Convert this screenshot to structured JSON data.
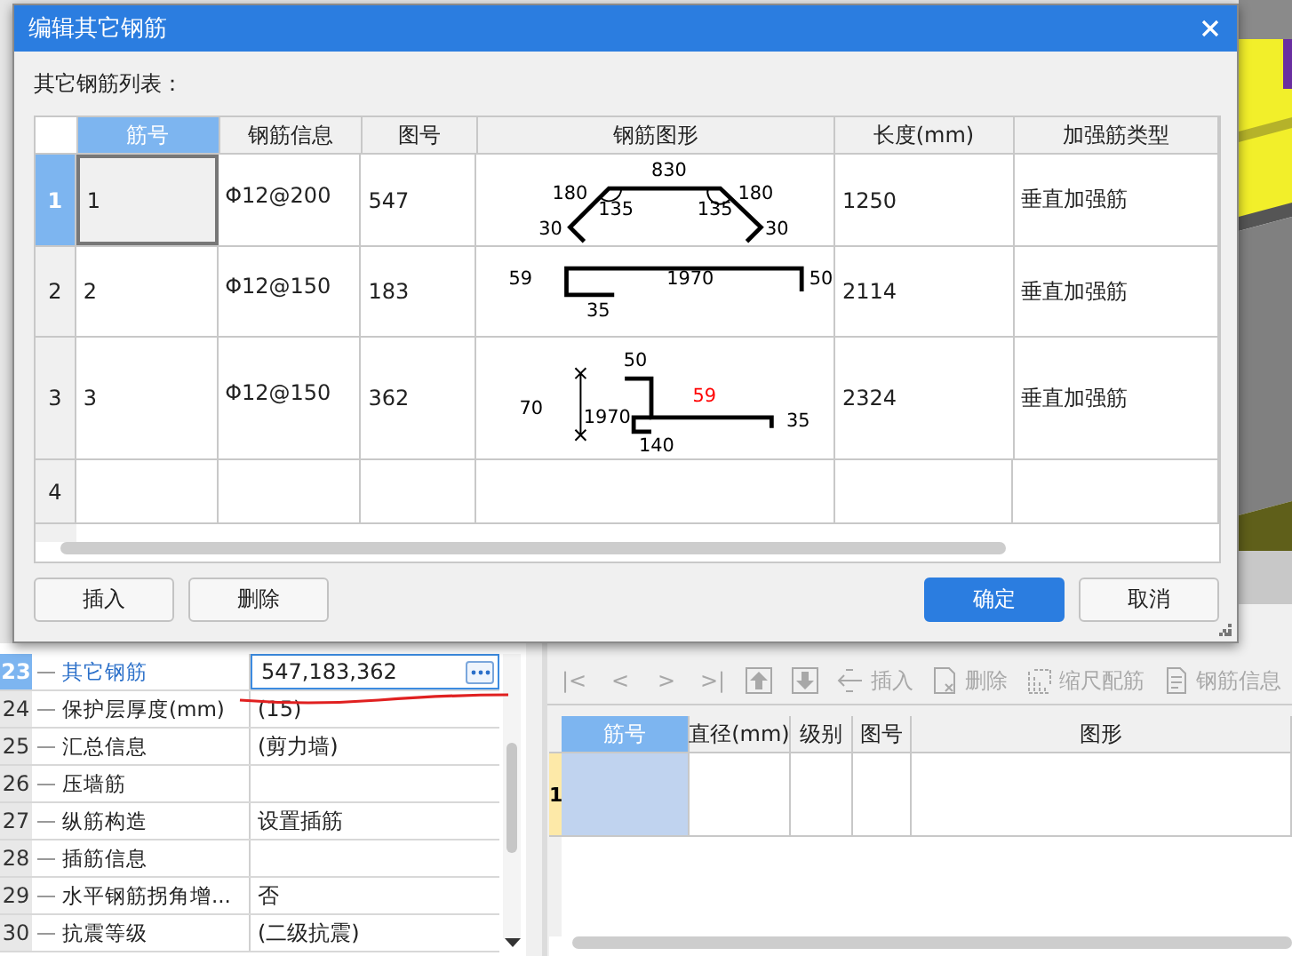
{
  "dialog": {
    "title": "编辑其它钢筋",
    "list_label": "其它钢筋列表：",
    "table": {
      "columns": [
        {
          "label": "筋号",
          "selected": true
        },
        {
          "label": "钢筋信息",
          "selected": false
        },
        {
          "label": "图号",
          "selected": false
        },
        {
          "label": "钢筋图形",
          "selected": false
        },
        {
          "label": "长度(mm)",
          "selected": false
        },
        {
          "label": "加强筋类型",
          "selected": false
        }
      ],
      "rows": [
        {
          "number": "1",
          "selected": true,
          "bar_number": "1",
          "rebar_info": "Φ12@200",
          "shape_number": "547",
          "shape": {
            "kind": "hat",
            "labels": [
              {
                "text": "830",
                "highlighted": false
              },
              {
                "text": "180",
                "highlighted": false
              },
              {
                "text": "135",
                "highlighted": false
              },
              {
                "text": "135",
                "highlighted": false
              },
              {
                "text": "180",
                "highlighted": false
              },
              {
                "text": "30",
                "highlighted": false
              },
              {
                "text": "30",
                "highlighted": false
              }
            ]
          },
          "length": "1250",
          "type": "垂直加强筋"
        },
        {
          "number": "2",
          "selected": false,
          "bar_number": "2",
          "rebar_info": "Φ12@150",
          "shape_number": "183",
          "shape": {
            "kind": "channel",
            "labels": [
              {
                "text": "59",
                "highlighted": false
              },
              {
                "text": "1970",
                "highlighted": false
              },
              {
                "text": "50",
                "highlighted": false
              },
              {
                "text": "35",
                "highlighted": false
              }
            ]
          },
          "length": "2114",
          "type": "垂直加强筋"
        },
        {
          "number": "3",
          "selected": false,
          "bar_number": "3",
          "rebar_info": "Φ12@150",
          "shape_number": "362",
          "shape": {
            "kind": "zbend",
            "labels": [
              {
                "text": "50",
                "highlighted": false
              },
              {
                "text": "59",
                "highlighted": true
              },
              {
                "text": "70",
                "highlighted": false
              },
              {
                "text": "1970",
                "highlighted": false
              },
              {
                "text": "140",
                "highlighted": false
              },
              {
                "text": "35",
                "highlighted": false
              }
            ]
          },
          "length": "2324",
          "type": "垂直加强筋"
        },
        {
          "number": "4",
          "selected": false
        }
      ]
    },
    "left_buttons": [
      "插入",
      "删除"
    ],
    "confirm": "确定",
    "cancel": "取消"
  },
  "properties": {
    "rows": [
      {
        "number": "23",
        "name": "其它钢筋",
        "value": "547,183,362",
        "selected": true
      },
      {
        "number": "24",
        "name": "保护层厚度(mm)",
        "value": "(15)",
        "selected": false
      },
      {
        "number": "25",
        "name": "汇总信息",
        "value": "(剪力墙)",
        "selected": false
      },
      {
        "number": "26",
        "name": "压墙筋",
        "selected": false
      },
      {
        "number": "27",
        "name": "纵筋构造",
        "value": "设置插筋",
        "selected": false
      },
      {
        "number": "28",
        "name": "插筋信息",
        "selected": false
      },
      {
        "number": "29",
        "name": "水平钢筋拐角增...",
        "value": "否",
        "selected": false
      },
      {
        "number": "30",
        "name": "抗震等级",
        "value": "(二级抗震)",
        "selected": false
      }
    ]
  },
  "rebar_panel": {
    "toolbar": [
      {
        "kind": "nav",
        "label": "|<",
        "disabled": true
      },
      {
        "kind": "nav",
        "label": "<",
        "disabled": true
      },
      {
        "kind": "nav",
        "label": ">",
        "disabled": true
      },
      {
        "kind": "nav",
        "label": ">|",
        "disabled": true
      },
      {
        "kind": "move_up",
        "disabled": true
      },
      {
        "kind": "move_down",
        "disabled": true
      },
      {
        "kind": "insert",
        "label": "插入",
        "disabled": true
      },
      {
        "kind": "delete",
        "label": "删除",
        "disabled": true
      },
      {
        "kind": "scale",
        "label": "缩尺配筋",
        "disabled": true
      },
      {
        "kind": "info",
        "label": "钢筋信息",
        "disabled": true
      }
    ],
    "columns": [
      {
        "label": "筋号",
        "selected": true
      },
      {
        "label": "直径(mm)",
        "selected": false
      },
      {
        "label": "级别",
        "selected": false
      },
      {
        "label": "图号",
        "selected": false
      },
      {
        "label": "图形",
        "selected": false
      }
    ],
    "rows": [
      {
        "number": "1",
        "selected": true
      }
    ]
  }
}
